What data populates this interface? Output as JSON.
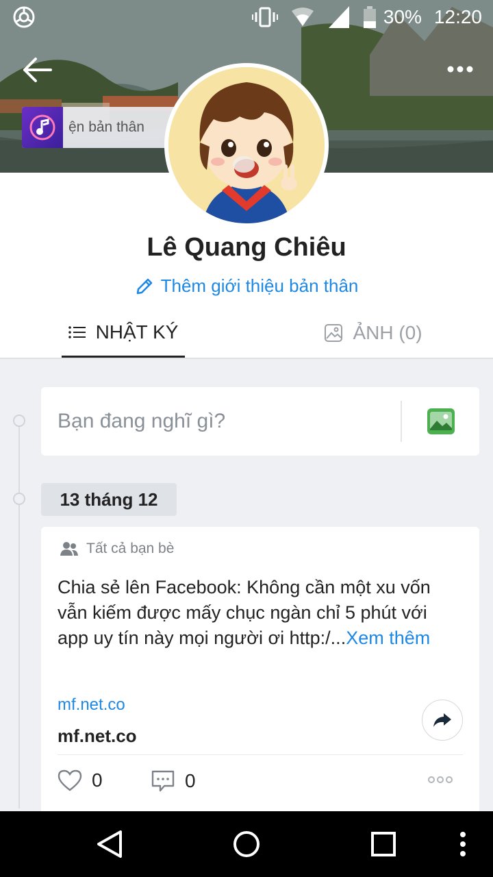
{
  "status_bar": {
    "battery": "30%",
    "time": "12:20"
  },
  "profile": {
    "music_text": "ện bản thân",
    "name": "Lê Quang Chiêu",
    "intro_link": "Thêm giới thiệu bản thân"
  },
  "tabs": [
    {
      "label": "NHẬT KÝ",
      "active": true
    },
    {
      "label": "ẢNH (0)",
      "active": false
    }
  ],
  "compose": {
    "placeholder": "Bạn đang nghĩ gì?"
  },
  "timeline": {
    "date_label": "13 tháng 12"
  },
  "post": {
    "privacy": "Tất cả bạn bè",
    "text": "Chia sẻ lên Facebook: Không cần một xu vốn vẫn kiếm được mấy chục ngàn chỉ 5 phút với app uy tín này mọi người ơi http:/...",
    "see_more": "Xem thêm",
    "link_url": "mf.net.co",
    "link_title": "mf.net.co",
    "likes": "0",
    "comments": "0"
  },
  "colors": {
    "accent": "#1e88e5",
    "background": "#eef0f3"
  },
  "icons": {
    "back": "arrow-left-icon",
    "more": "more-horizontal-icon",
    "edit": "pencil-icon",
    "diary": "list-icon",
    "photos": "image-icon",
    "compose_photo": "photo-icon",
    "privacy": "friends-icon",
    "share": "share-arrow-icon",
    "like": "heart-icon",
    "comment": "comment-icon"
  }
}
